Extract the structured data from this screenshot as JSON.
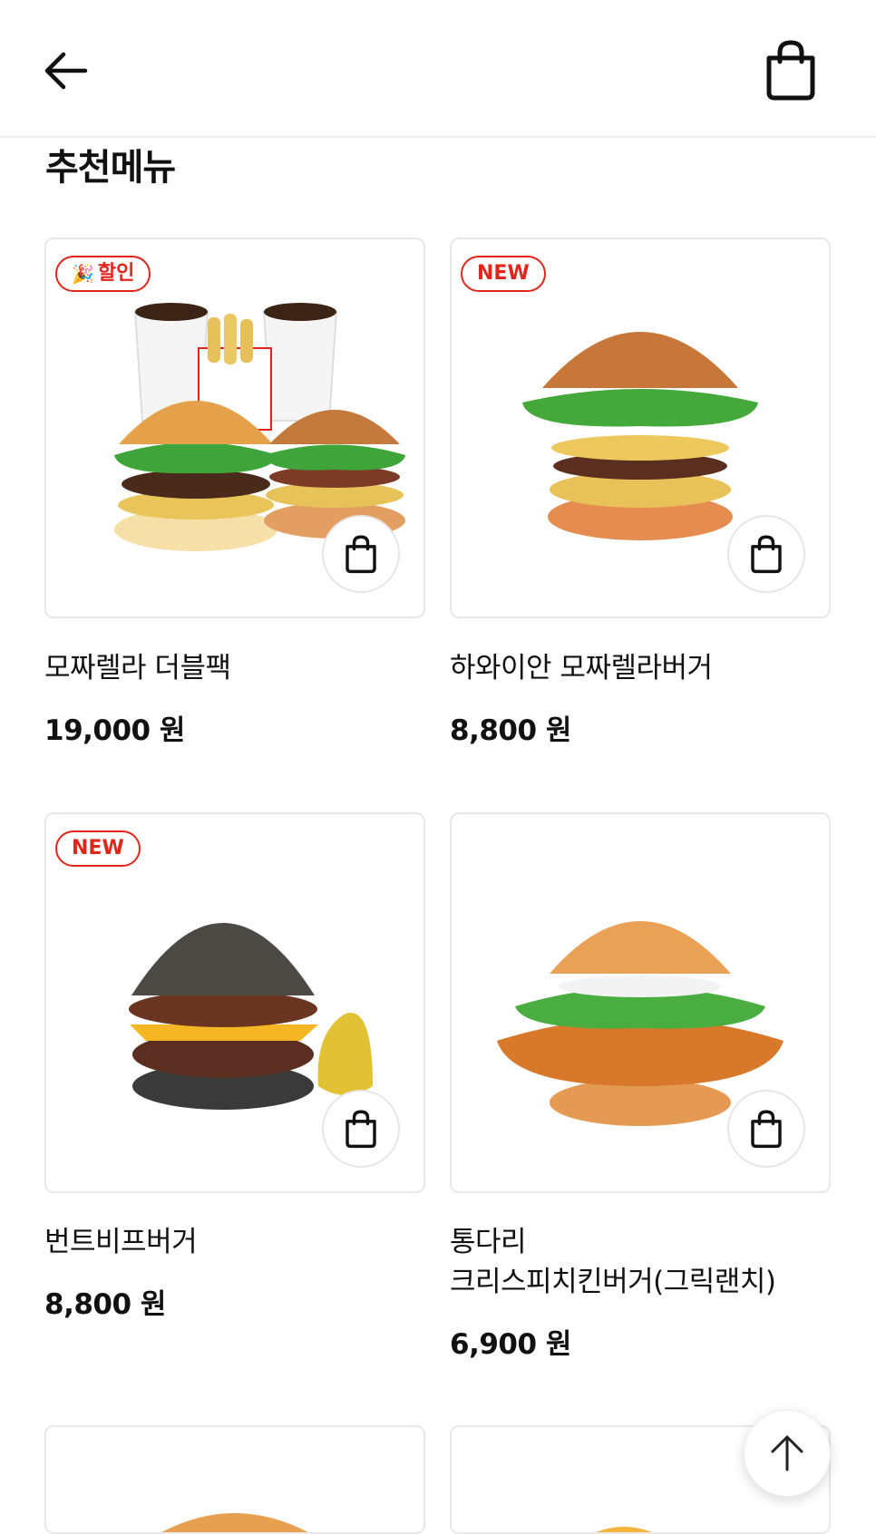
{
  "section": {
    "title": "추천메뉴"
  },
  "products": [
    {
      "badge": "할인",
      "badge_icon": "party-popper-icon",
      "name": "모짜렐라 더블팩",
      "price": "19,000 원"
    },
    {
      "badge": "NEW",
      "name": "하와이안 모짜렐라버거",
      "price": "8,800 원"
    },
    {
      "badge": "NEW",
      "name": "번트비프버거",
      "price": "8,800 원"
    },
    {
      "badge": "",
      "name_line1": "통다리",
      "name_line2": "크리스피치킨버거(그릭랜치)",
      "price": "6,900 원"
    }
  ],
  "colors": {
    "accent": "#e0261b",
    "border": "#e8e8e8"
  },
  "icons": [
    "back-arrow-icon",
    "shopping-bag-icon",
    "arrow-up-icon"
  ]
}
